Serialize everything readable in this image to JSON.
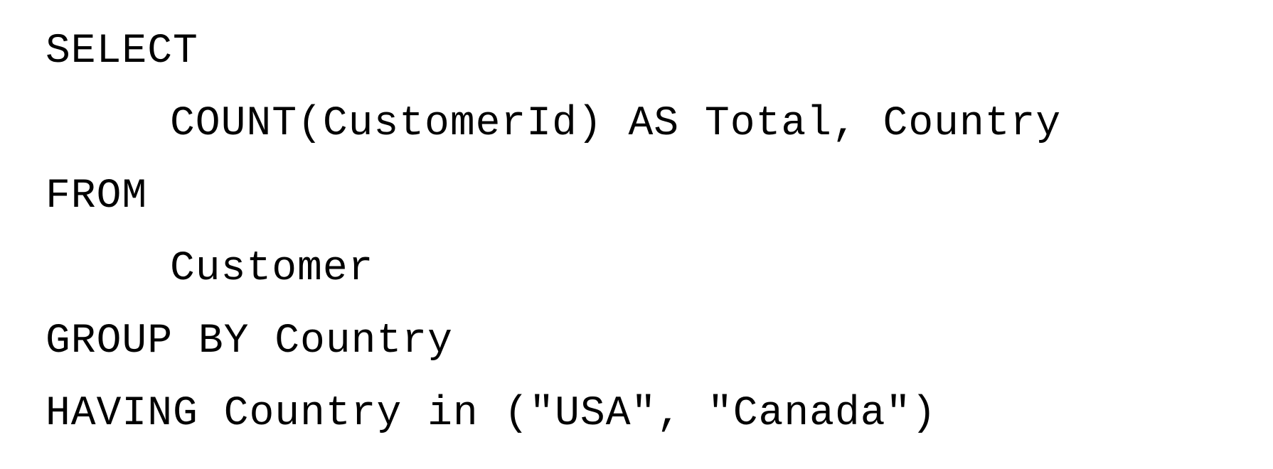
{
  "code": {
    "lines": [
      "SELECT",
      "COUNT(CustomerId) AS Total, Country",
      "FROM",
      "Customer",
      "GROUP BY Country",
      "HAVING Country in (\"USA\", \"Canada\")"
    ]
  }
}
